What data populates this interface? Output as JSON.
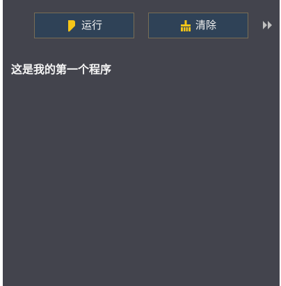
{
  "colors": {
    "panel_background": "#43444d",
    "button_background": "#2f4257",
    "button_border": "#7a6e55",
    "icon_yellow": "#f5c518",
    "text": "#f2f2f2",
    "expand_icon": "#bfbfbf"
  },
  "toolbar": {
    "run": {
      "icon": "play-icon",
      "label": "运行"
    },
    "clear": {
      "icon": "broom-icon",
      "label": "清除"
    },
    "expand": {
      "icon": "double-chevron-right-icon"
    }
  },
  "output": {
    "lines": [
      "这是我的第一个程序"
    ]
  }
}
